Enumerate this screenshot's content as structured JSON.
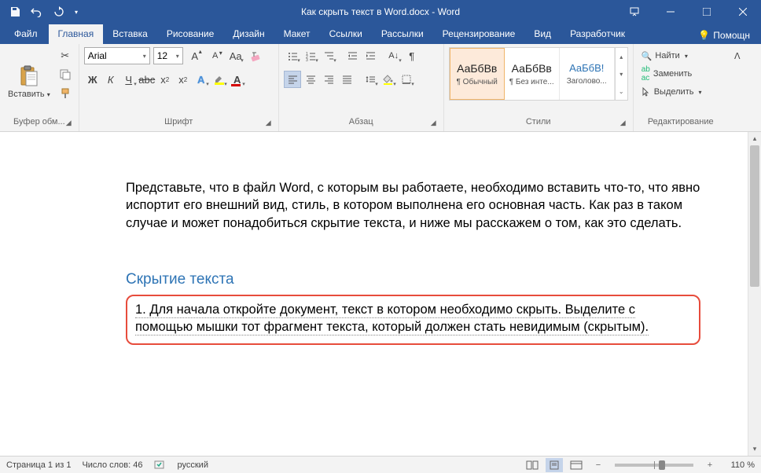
{
  "title": "Как скрыть текст в Word.docx  -  Word",
  "tabs": {
    "file": "Файл",
    "home": "Главная",
    "insert": "Вставка",
    "draw": "Рисование",
    "design": "Дизайн",
    "layout": "Макет",
    "references": "Ссылки",
    "mailings": "Рассылки",
    "review": "Рецензирование",
    "view": "Вид",
    "developer": "Разработчик"
  },
  "help": "Помощн",
  "ribbon": {
    "clipboard": {
      "label": "Буфер обм...",
      "paste": "Вставить"
    },
    "font": {
      "label": "Шрифт",
      "name": "Arial",
      "size": "12"
    },
    "paragraph": {
      "label": "Абзац"
    },
    "styles": {
      "label": "Стили",
      "items": [
        {
          "preview": "АаБбВв",
          "name": "¶ Обычный"
        },
        {
          "preview": "АаБбВв",
          "name": "¶ Без инте..."
        },
        {
          "preview": "АаБбВ!",
          "name": "Заголово..."
        }
      ]
    },
    "editing": {
      "label": "Редактирование",
      "find": "Найти",
      "replace": "Заменить",
      "select": "Выделить"
    }
  },
  "document": {
    "para1": "Представьте, что в файл Word, с которым вы работаете, необходимо вставить что-то, что явно испортит его внешний вид, стиль, в котором выполнена его основная часть. Как раз в таком случае и может понадобиться скрытие текста, и ниже мы расскажем о том, как это сделать.",
    "heading": "Скрытие текста",
    "para2": "1. Для начала откройте документ, текст в котором необходимо скрыть. Выделите с помощью мышки тот фрагмент текста, который должен стать невидимым (скрытым)."
  },
  "status": {
    "page": "Страница 1 из 1",
    "words": "Число слов: 46",
    "lang": "русский",
    "zoom": "110 %"
  }
}
